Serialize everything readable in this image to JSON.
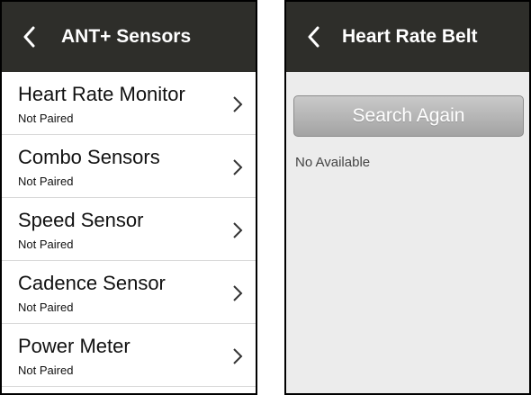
{
  "left_screen": {
    "title": "ANT+ Sensors",
    "back_icon": "chevron-left-icon",
    "items": [
      {
        "label": "Heart Rate Monitor",
        "status": "Not Paired"
      },
      {
        "label": "Combo Sensors",
        "status": "Not Paired"
      },
      {
        "label": "Speed Sensor",
        "status": "Not Paired"
      },
      {
        "label": "Cadence Sensor",
        "status": "Not Paired"
      },
      {
        "label": "Power Meter",
        "status": "Not Paired"
      }
    ]
  },
  "right_screen": {
    "title": "Heart Rate Belt",
    "back_icon": "chevron-left-icon",
    "search_button_label": "Search Again",
    "empty_message": "No Available"
  },
  "colors": {
    "titlebar_bg": "#2e2e2a",
    "title_text": "#ffffff",
    "right_screen_bg": "#ececec",
    "button_gradient_top": "#c9c9c9",
    "button_gradient_bottom": "#a3a3a3"
  }
}
